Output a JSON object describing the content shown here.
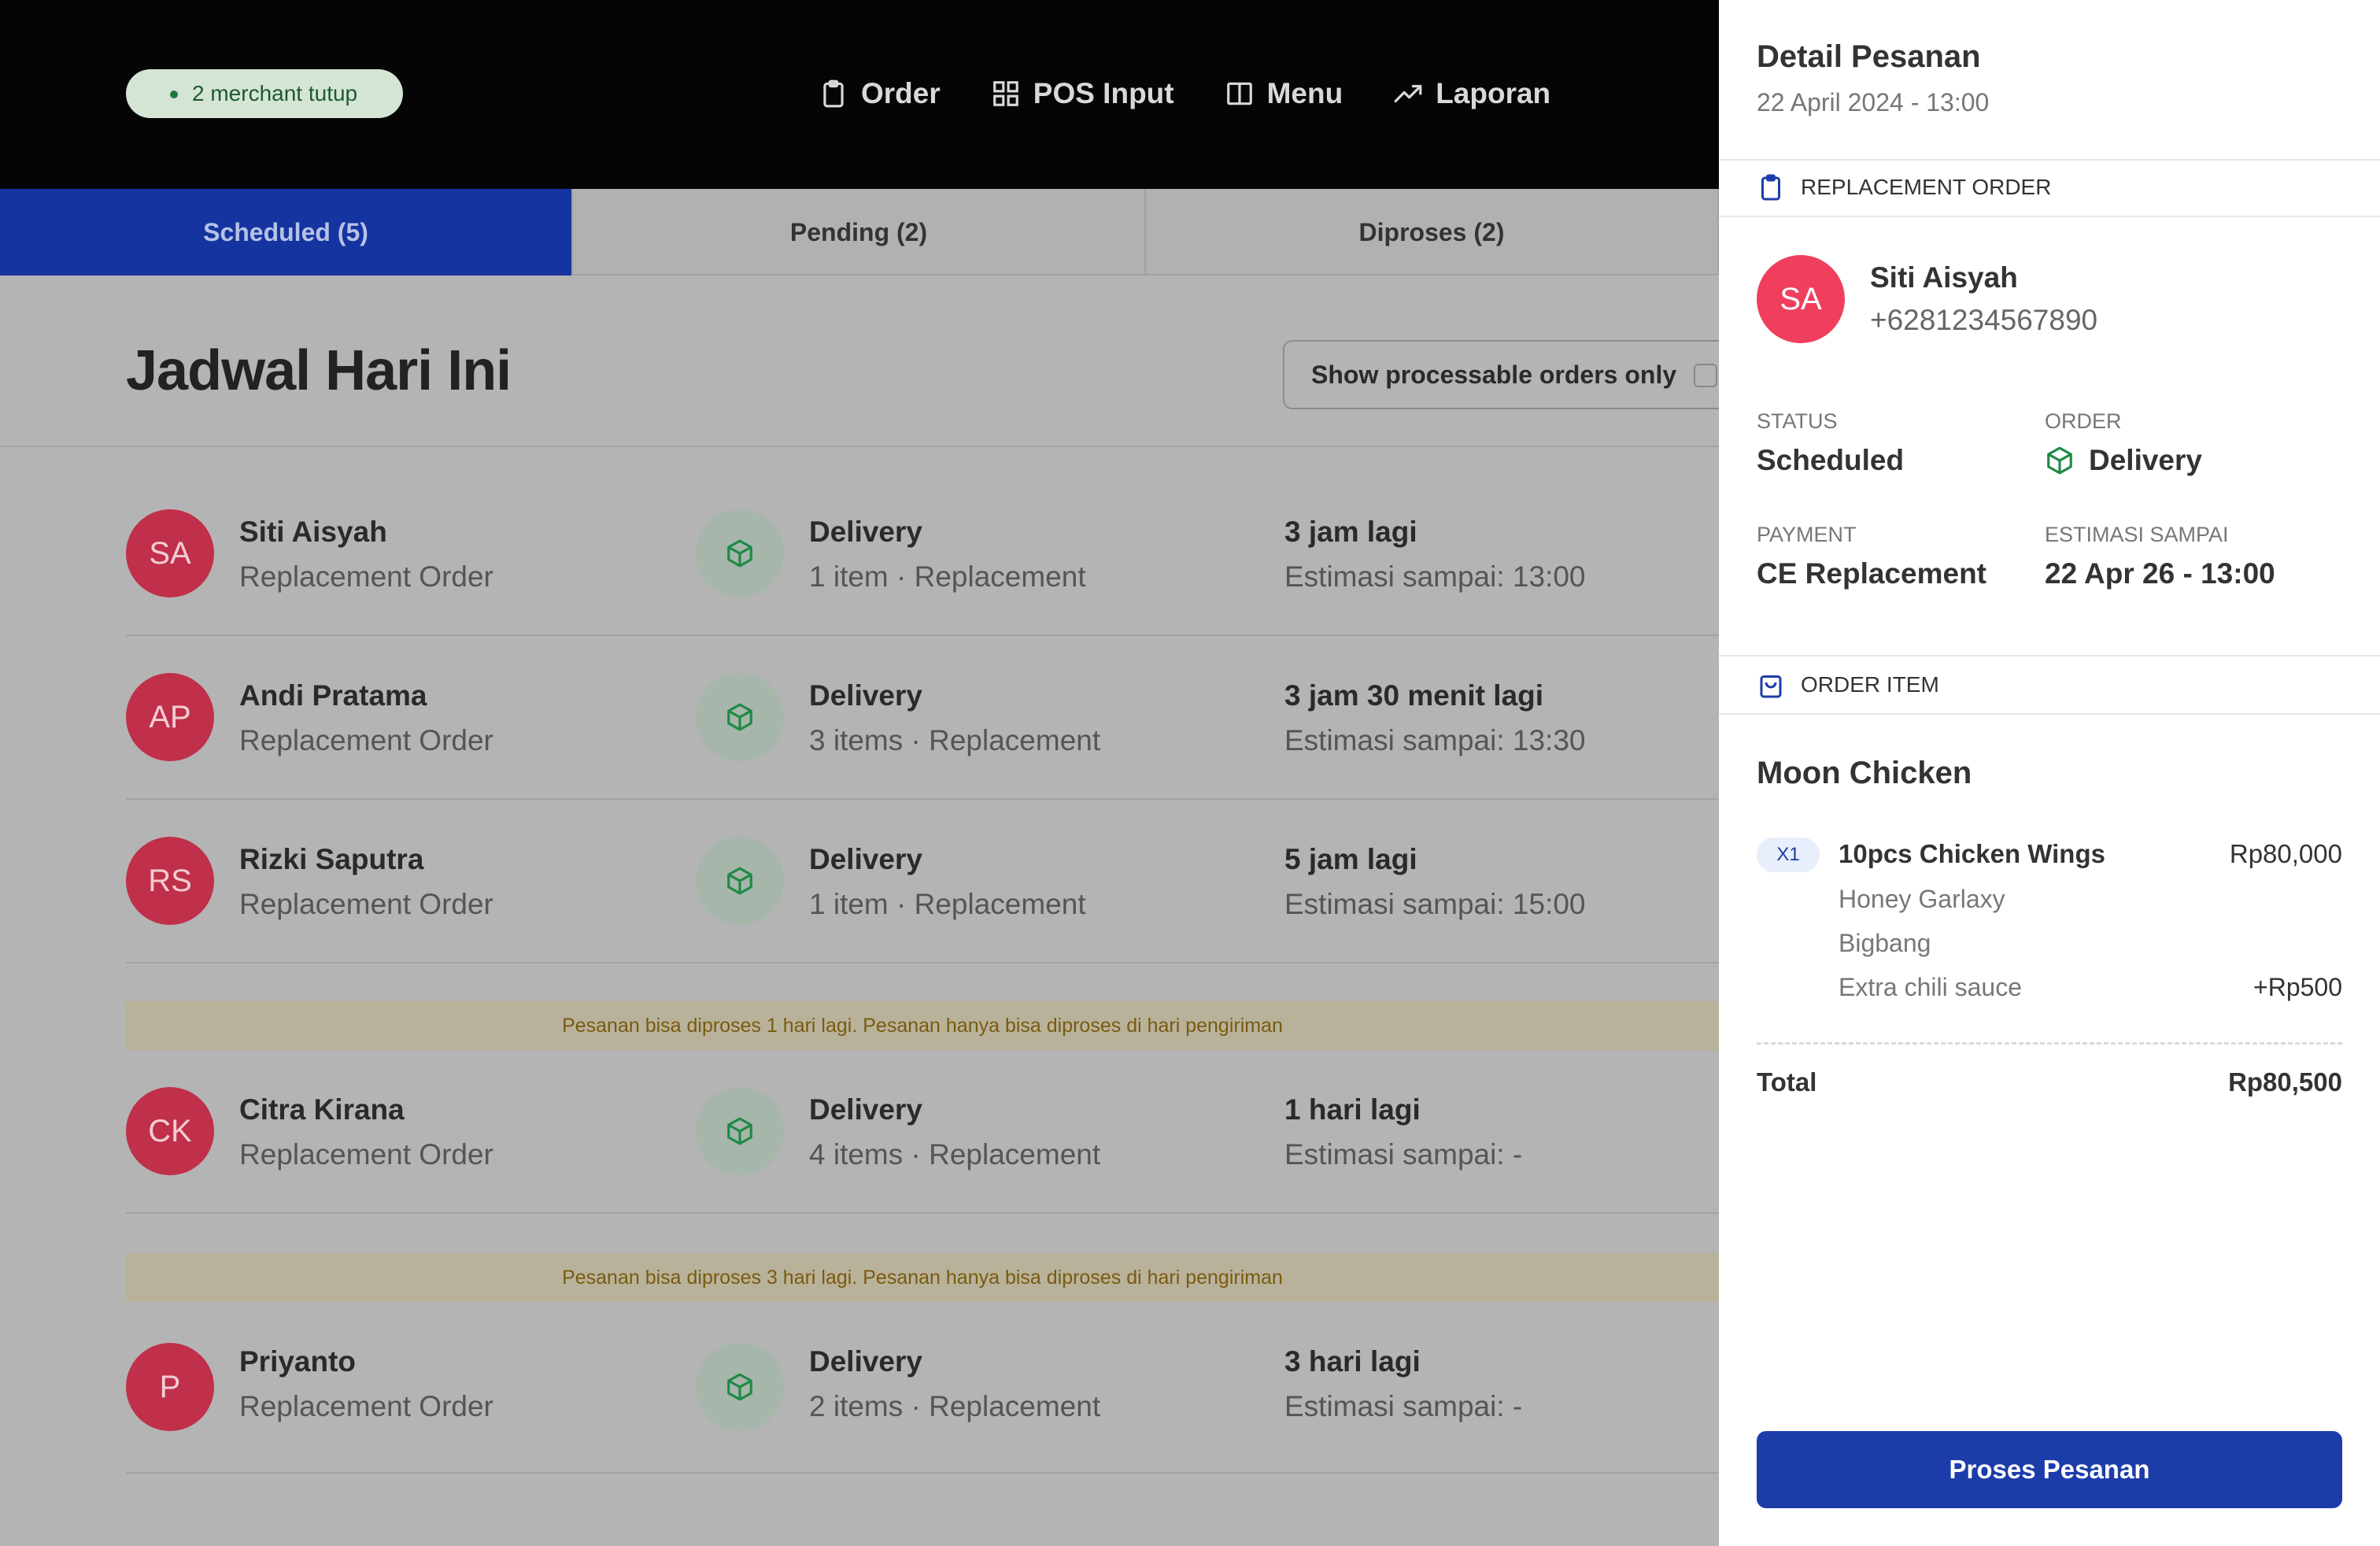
{
  "header": {
    "merchant_status": "2 merchant tutup",
    "nav": [
      {
        "label": "Order",
        "icon": "clipboard-icon"
      },
      {
        "label": "POS Input",
        "icon": "grid-icon"
      },
      {
        "label": "Menu",
        "icon": "book-icon"
      },
      {
        "label": "Laporan",
        "icon": "trend-up-icon"
      }
    ]
  },
  "tabs": [
    {
      "label": "Scheduled (5)",
      "active": true
    },
    {
      "label": "Pending (2)",
      "active": false
    },
    {
      "label": "Diproses (2)",
      "active": false
    }
  ],
  "main": {
    "title": "Jadwal Hari Ini",
    "filter_label": "Show processable orders only",
    "orders": [
      {
        "initials": "SA",
        "name": "Siti Aisyah",
        "type": "Replacement Order",
        "method": "Delivery",
        "detail": "1 item · Replacement",
        "eta": "3 jam lagi",
        "eta_sub": "Estimasi sampai: 13:00"
      },
      {
        "initials": "AP",
        "name": "Andi Pratama",
        "type": "Replacement Order",
        "method": "Delivery",
        "detail": "3 items · Replacement",
        "eta": "3 jam 30 menit lagi",
        "eta_sub": "Estimasi sampai: 13:30"
      },
      {
        "initials": "RS",
        "name": "Rizki Saputra",
        "type": "Replacement Order",
        "method": "Delivery",
        "detail": "1 item · Replacement",
        "eta": "5 jam lagi",
        "eta_sub": "Estimasi sampai: 15:00"
      },
      {
        "initials": "CK",
        "name": "Citra Kirana",
        "type": "Replacement Order",
        "method": "Delivery",
        "detail": "4 items · Replacement",
        "eta": "1 hari lagi",
        "eta_sub": "Estimasi sampai: -"
      },
      {
        "initials": "P",
        "name": "Priyanto",
        "type": "Replacement Order",
        "method": "Delivery",
        "detail": "2 items · Replacement",
        "eta": "3 hari lagi",
        "eta_sub": "Estimasi sampai: -"
      }
    ],
    "banners": [
      "Pesanan bisa diproses 1 hari lagi. Pesanan hanya bisa diproses di hari pengiriman",
      "Pesanan bisa diproses 3 hari lagi. Pesanan hanya bisa diproses di hari pengiriman"
    ]
  },
  "detail": {
    "title": "Detail Pesanan",
    "date": "22 April 2024 - 13:00",
    "order_section": "REPLACEMENT ORDER",
    "customer": {
      "initials": "SA",
      "name": "Siti Aisyah",
      "phone": "+6281234567890"
    },
    "status_label": "STATUS",
    "status_value": "Scheduled",
    "order_label": "ORDER",
    "order_value": "Delivery",
    "payment_label": "PAYMENT",
    "payment_value": "CE Replacement",
    "eta_label": "ESTIMASI SAMPAI",
    "eta_value": "22 Apr 26 - 13:00",
    "items_section": "ORDER ITEM",
    "store": "Moon Chicken",
    "item": {
      "qty": "X1",
      "name": "10pcs Chicken Wings",
      "price": "Rp80,000",
      "modifiers": [
        "Honey Garlaxy",
        "Bigbang",
        "Extra chili sauce"
      ],
      "modifier_price": "+Rp500"
    },
    "total_label": "Total",
    "total_value": "Rp80,500",
    "cta": "Proses Pesanan"
  },
  "colors": {
    "accent": "#1c3caa",
    "avatar_red": "#ef3f5d",
    "delivery_green": "#1e8a46",
    "banner_bg": "#b8b29a"
  }
}
